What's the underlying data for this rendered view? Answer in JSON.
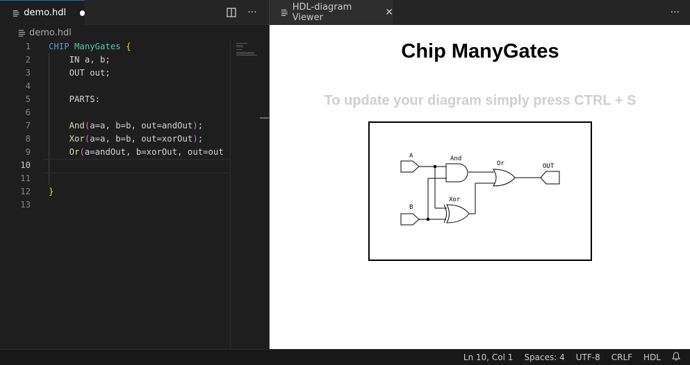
{
  "editor": {
    "tab_label": "demo.hdl",
    "breadcrumb": "demo.hdl",
    "lines": [
      {
        "n": "1",
        "text": "CHIP ManyGates {"
      },
      {
        "n": "2",
        "text": "    IN a, b;"
      },
      {
        "n": "3",
        "text": "    OUT out;"
      },
      {
        "n": "4",
        "text": ""
      },
      {
        "n": "5",
        "text": "    PARTS:"
      },
      {
        "n": "6",
        "text": ""
      },
      {
        "n": "7",
        "text": "    And(a=a, b=b, out=andOut);"
      },
      {
        "n": "8",
        "text": "    Xor(a=a, b=b, out=xorOut);"
      },
      {
        "n": "9",
        "text": "    Or(a=andOut, b=xorOut, out=out"
      },
      {
        "n": "10",
        "text": ""
      },
      {
        "n": "11",
        "text": ""
      },
      {
        "n": "12",
        "text": "}"
      },
      {
        "n": "13",
        "text": ""
      }
    ],
    "active_line": "10",
    "icons": {
      "file": "file-lines-icon",
      "split": "split-editor-icon",
      "more": "more-actions-icon",
      "dirty": "unsaved-dot-icon"
    }
  },
  "viewer": {
    "tab_label": "HDL-diagram Viewer",
    "title": "Chip ManyGates",
    "hint": "To update your diagram simply press CTRL + S",
    "diagram": {
      "input_a": "A",
      "input_b": "B",
      "gate_and": "And",
      "gate_xor": "Xor",
      "gate_or": "Or",
      "output": "OUT"
    }
  },
  "status": {
    "position": "Ln 10, Col 1",
    "spaces": "Spaces: 4",
    "encoding": "UTF-8",
    "eol": "CRLF",
    "language": "HDL"
  },
  "colors": {
    "accent": "#0078d4",
    "keyword": "#569cd6",
    "type": "#4ec9b0",
    "function": "#dcdcaa",
    "bracket": "#ffd700",
    "bracket2": "#da70d6"
  }
}
